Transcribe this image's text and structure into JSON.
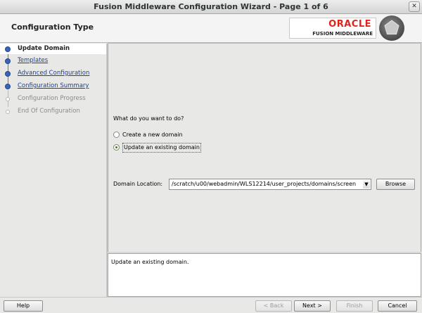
{
  "window": {
    "title": "Fusion Middleware Configuration Wizard - Page 1 of 6",
    "close_glyph": "✕"
  },
  "header": {
    "title": "Configuration Type",
    "brand_name": "ORACLE",
    "brand_sub": "FUSION MIDDLEWARE",
    "brand_color": "#e2231a"
  },
  "sidebar": {
    "steps": [
      {
        "label": "Update Domain",
        "state": "current"
      },
      {
        "label": "Templates",
        "state": "link"
      },
      {
        "label": "Advanced Configuration",
        "state": "link"
      },
      {
        "label": "Configuration Summary",
        "state": "link"
      },
      {
        "label": "Configuration Progress",
        "state": "disabled"
      },
      {
        "label": "End Of Configuration",
        "state": "disabled"
      }
    ]
  },
  "main": {
    "question": "What do you want to do?",
    "options": [
      {
        "label": "Create a new domain",
        "selected": false
      },
      {
        "label": "Update an existing domain",
        "selected": true
      }
    ],
    "domain_location_label": "Domain Location:",
    "domain_location_value": "/scratch/u00/webadmin/WLS12214/user_projects/domains/screen",
    "browse_label": "Browse"
  },
  "description": {
    "text": "Update an existing domain."
  },
  "footer": {
    "help_label": "Help",
    "back_label": "< Back",
    "next_label": "Next >",
    "finish_label": "Finish",
    "cancel_label": "Cancel"
  }
}
